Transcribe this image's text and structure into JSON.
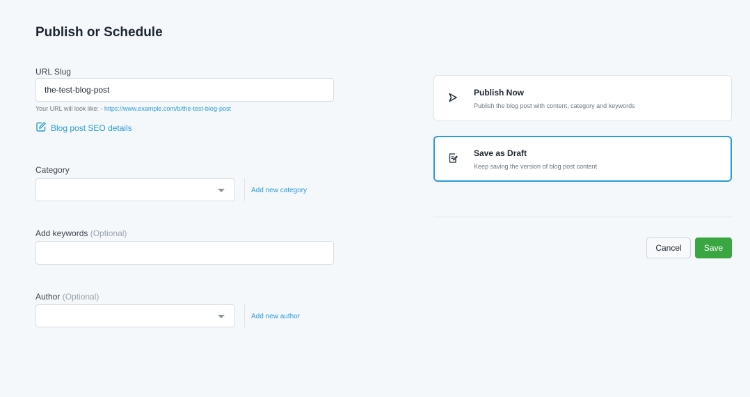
{
  "page": {
    "title": "Publish or Schedule"
  },
  "url_slug": {
    "label": "URL Slug",
    "value": "the-test-blog-post",
    "hint_prefix": "Your URL will look like: - ",
    "hint_url": "https://www.example.com/b/the-test-blog-post",
    "seo_link": "Blog post SEO details"
  },
  "category": {
    "label": "Category",
    "value": "",
    "add_link": "Add new category"
  },
  "keywords": {
    "label": "Add keywords",
    "optional": "(Optional)",
    "value": ""
  },
  "author": {
    "label": "Author",
    "optional": "(Optional)",
    "value": "",
    "add_link": "Add new author"
  },
  "options": [
    {
      "title": "Publish Now",
      "description": "Publish the blog post with content, category and keywords",
      "icon": "send-icon",
      "selected": false
    },
    {
      "title": "Save as Draft",
      "description": "Keep saving the version of blog post content",
      "icon": "draft-icon",
      "selected": true
    }
  ],
  "actions": {
    "cancel": "Cancel",
    "save": "Save"
  },
  "colors": {
    "accent": "#2a9bd6",
    "save": "#3aa641",
    "background": "#f5f8fa"
  }
}
